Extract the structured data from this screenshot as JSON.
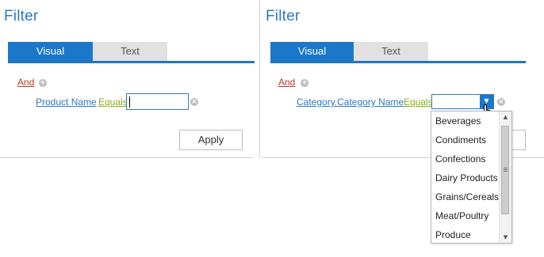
{
  "left_panel": {
    "title": "Filter",
    "tabs": {
      "visual": "Visual",
      "text": "Text"
    },
    "logic_operator": "And",
    "condition": {
      "field": "Product Name",
      "operator": "Equals",
      "value": ""
    },
    "apply_label": "Apply"
  },
  "right_panel": {
    "title": "Filter",
    "tabs": {
      "visual": "Visual",
      "text": "Text"
    },
    "logic_operator": "And",
    "condition": {
      "field": "Category.Category Name",
      "operator": "Equals",
      "value": ""
    },
    "dropdown_options": [
      "Beverages",
      "Condiments",
      "Confections",
      "Dairy Products",
      "Grains/Cereals",
      "Meat/Poultry",
      "Produce"
    ]
  },
  "colors": {
    "accent": "#1b77c9",
    "title": "#2b78c5",
    "logic_link": "#c0392b",
    "operator_link": "#8fae1b"
  },
  "icons": {
    "add": "plus-circle-icon",
    "remove": "close-circle-icon",
    "dropdown": "caret-down-icon",
    "cursor": "hand-pointer-icon"
  }
}
